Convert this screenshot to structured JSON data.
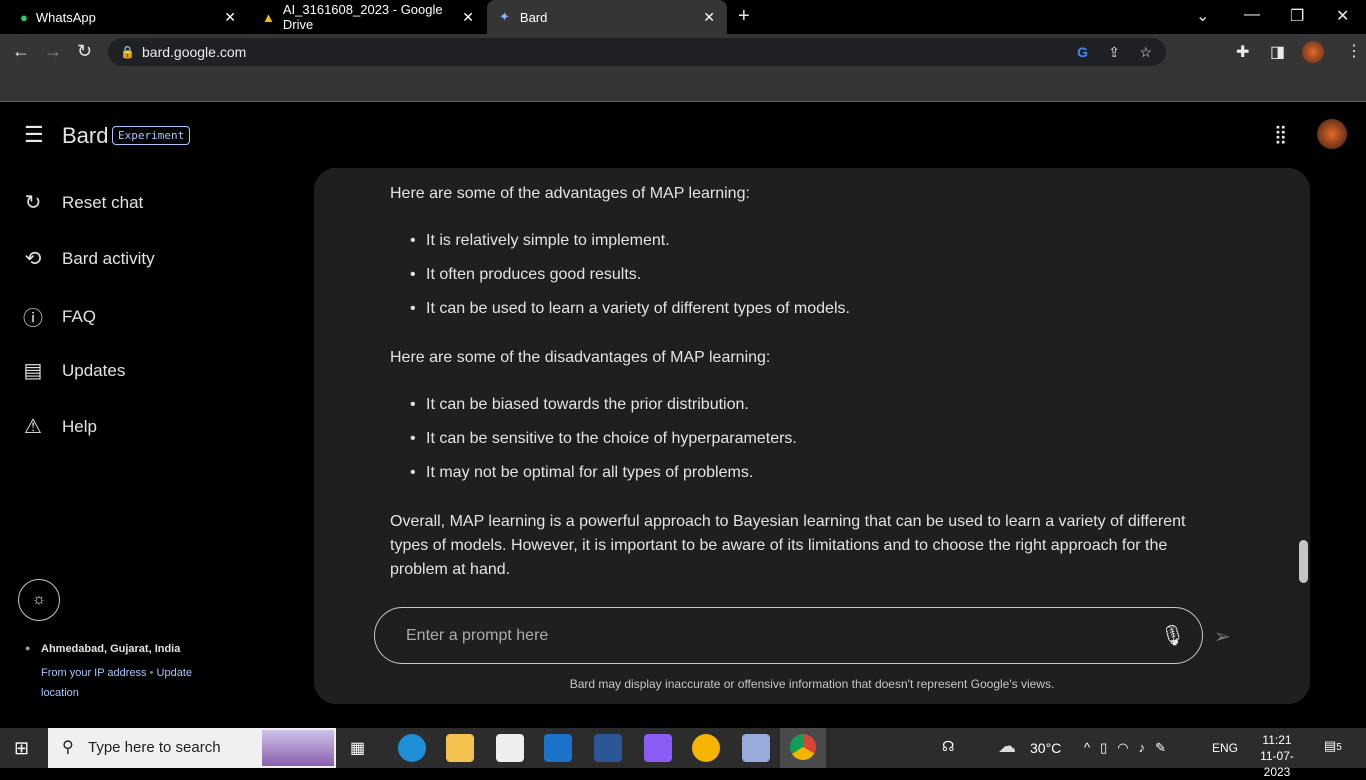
{
  "browser": {
    "tabs": [
      {
        "title": "WhatsApp"
      },
      {
        "title": "AI_3161608_2023 - Google Drive"
      },
      {
        "title": "Bard"
      }
    ],
    "url": "bard.google.com"
  },
  "header": {
    "title": "Bard",
    "badge": "Experiment"
  },
  "sidebar": {
    "items": [
      {
        "label": "Reset chat",
        "icon": "reset-icon"
      },
      {
        "label": "Bard activity",
        "icon": "history-icon"
      },
      {
        "label": "FAQ",
        "icon": "help-circle-icon"
      },
      {
        "label": "Updates",
        "icon": "calendar-icon"
      },
      {
        "label": "Help",
        "icon": "feedback-icon"
      }
    ],
    "location": {
      "place": "Ahmedabad, Gujarat, India",
      "source": "From your IP address",
      "separator": "•",
      "update": "Update location"
    }
  },
  "response": {
    "adv_intro": "Here are some of the advantages of MAP learning:",
    "advantages": [
      "It is relatively simple to implement.",
      "It often produces good results.",
      "It can be used to learn a variety of different types of models."
    ],
    "dis_intro": "Here are some of the disadvantages of MAP learning:",
    "disadvantages": [
      "It can be biased towards the prior distribution.",
      "It can be sensitive to the choice of hyperparameters.",
      "It may not be optimal for all types of problems."
    ],
    "conclusion": "Overall, MAP learning is a powerful approach to Bayesian learning that can be used to learn a variety of different types of models. However, it is important to be aware of its limitations and to choose the right approach for the problem at hand."
  },
  "input": {
    "placeholder": "Enter a prompt here"
  },
  "disclaimer": "Bard may display inaccurate or offensive information that doesn't represent Google's views.",
  "taskbar": {
    "search_placeholder": "Type here to search",
    "weather": "30°C",
    "lang": "ENG",
    "time": "11:21",
    "date": "11-07-2023",
    "notifications": "5"
  }
}
